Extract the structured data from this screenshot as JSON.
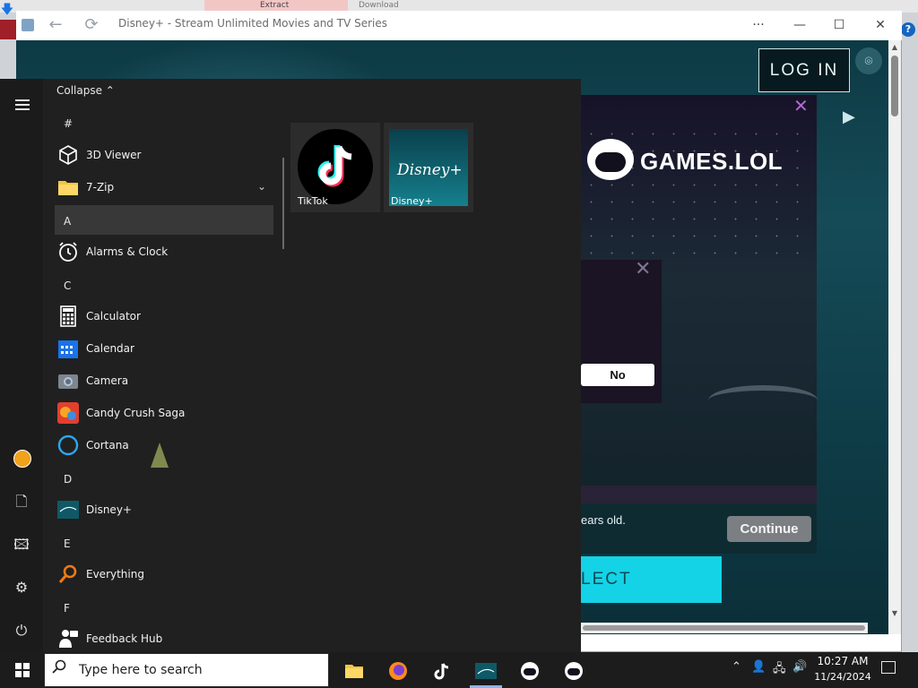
{
  "desktop": {
    "bg_tab_label": "Extract",
    "bg_tab2_label": "Download",
    "help_label": "?"
  },
  "browser": {
    "title": "Disney+ - Stream Unlimited Movies and TV Series",
    "more_label": "···",
    "login_label": "LOG IN"
  },
  "overlay": {
    "brand": "GAMES.LOL",
    "close_label": "✕",
    "dialog_close_label": "✕",
    "no_label": "No",
    "age_text": "ears old.",
    "continue_label": "Continue",
    "select_label": "LECT"
  },
  "start_menu": {
    "collapse_label": "Collapse ⌃",
    "groups": {
      "hash": "#",
      "a": "A",
      "c": "C",
      "d": "D",
      "e": "E",
      "f": "F"
    },
    "apps": {
      "viewer3d": "3D Viewer",
      "zip": "7-Zip",
      "alarms": "Alarms & Clock",
      "calculator": "Calculator",
      "calendar": "Calendar",
      "camera": "Camera",
      "candy": "Candy Crush Saga",
      "cortana": "Cortana",
      "disney": "Disney+",
      "everything": "Everything",
      "feedback": "Feedback Hub"
    },
    "tiles": {
      "tiktok": "TikTok",
      "disney": "Disney+",
      "disney_logo_text": "Disney+"
    }
  },
  "taskbar": {
    "search_placeholder": "Type here to search",
    "time": "10:27 AM",
    "date": "11/24/2024"
  }
}
